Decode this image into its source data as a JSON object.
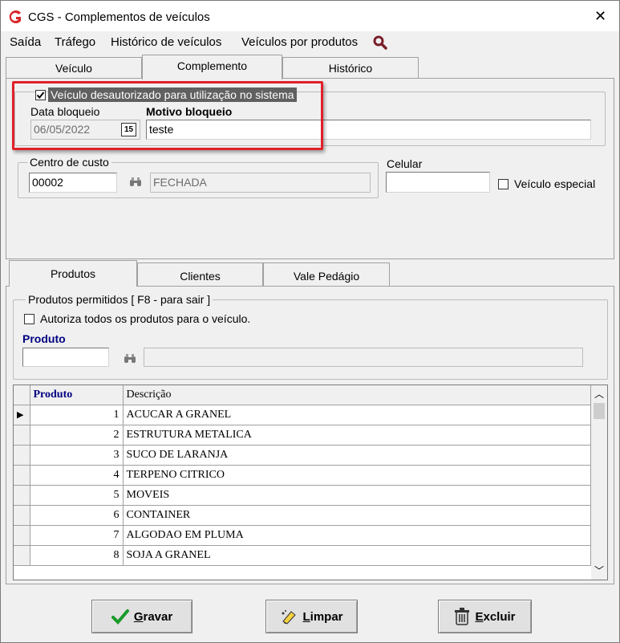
{
  "window": {
    "title": "CGS - Complementos de veículos",
    "close_glyph": "✕",
    "logo_color": "#d9262a"
  },
  "menu": {
    "items": [
      "Saída",
      "Tráfego",
      "Histórico de veículos",
      "Veículos por produtos"
    ],
    "search_icon": "search-icon"
  },
  "tabs": [
    "Veículo",
    "Complemento",
    "Histórico"
  ],
  "complemento": {
    "unauthorized_checkbox_label": "Veículo desautorizado para utilização no sistema",
    "unauthorized_checked": true,
    "data_bloqueio_label": "Data bloqueio",
    "data_bloqueio_value": "06/05/2022",
    "calendar_label": "15",
    "motivo_label": "Motivo bloqueio",
    "motivo_value": "teste",
    "centro_custo_label": "Centro de custo",
    "centro_custo_code": "00002",
    "centro_custo_desc": "FECHADA",
    "celular_label": "Celular",
    "celular_value": "",
    "veiculo_especial_label": "Veículo especial",
    "veiculo_especial_checked": false
  },
  "subtabs": [
    "Produtos",
    "Clientes",
    "Vale Pedágio"
  ],
  "produtos": {
    "group_label": "Produtos permitidos [ F8 - para sair ]",
    "autoriza_label": "Autoriza todos os produtos para o veículo.",
    "autoriza_checked": false,
    "produto_label": "Produto",
    "produto_value": "",
    "produto_desc": ""
  },
  "table": {
    "headers": [
      "Produto",
      "Descrição"
    ],
    "rows": [
      {
        "id": "1",
        "desc": "ACUCAR A GRANEL"
      },
      {
        "id": "2",
        "desc": "ESTRUTURA METALICA"
      },
      {
        "id": "3",
        "desc": "SUCO DE LARANJA"
      },
      {
        "id": "4",
        "desc": "TERPENO CITRICO"
      },
      {
        "id": "5",
        "desc": "MOVEIS"
      },
      {
        "id": "6",
        "desc": "CONTAINER"
      },
      {
        "id": "7",
        "desc": "ALGODAO EM PLUMA"
      },
      {
        "id": "8",
        "desc": "SOJA A GRANEL"
      }
    ]
  },
  "buttons": {
    "gravar_accel": "G",
    "gravar_rest": "ravar",
    "limpar_accel": "L",
    "limpar_rest": "impar",
    "excluir_accel": "E",
    "excluir_rest": "xcluir"
  },
  "colors": {
    "highlight_red": "#e0202a",
    "header_blue": "#000080",
    "gravar_check_green": "#1a9a2a"
  }
}
